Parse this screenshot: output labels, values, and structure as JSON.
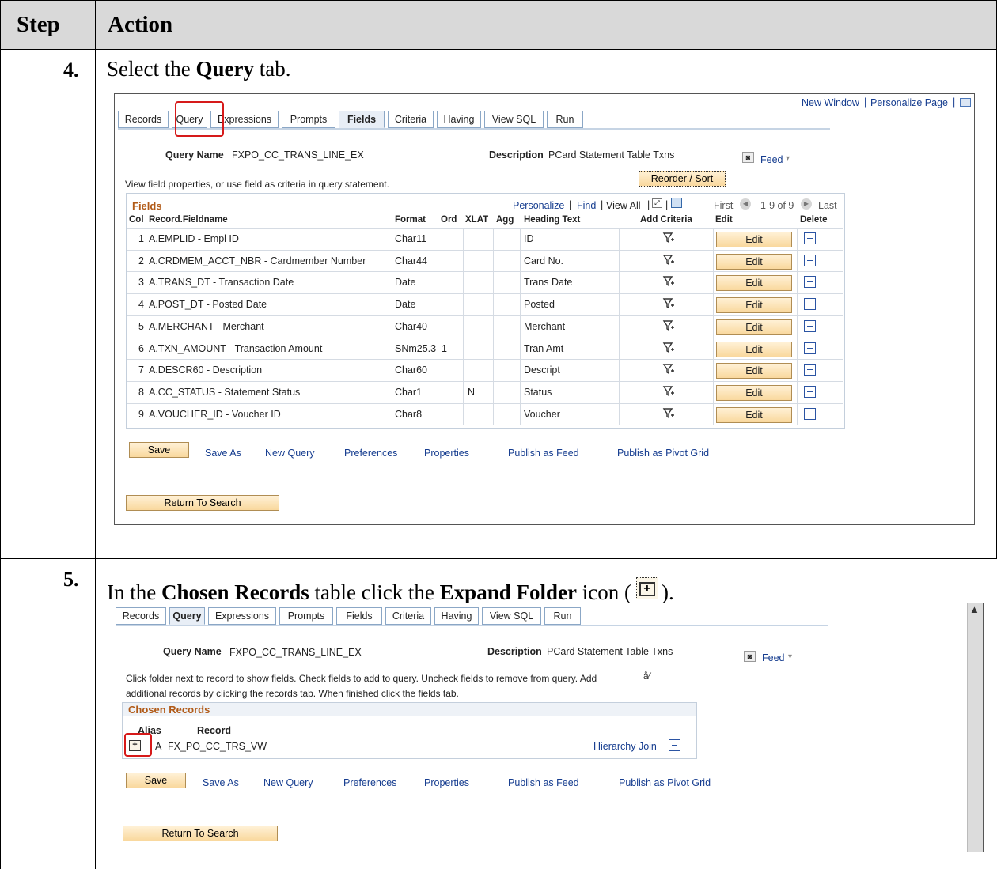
{
  "header": {
    "step_label": "Step",
    "action_label": "Action"
  },
  "step4": {
    "number": "4.",
    "instruction_pre": "Select the ",
    "instruction_bold": "Query",
    "instruction_post": " tab.",
    "top_links": {
      "new_window": "New Window",
      "personalize_page": "Personalize Page"
    },
    "tabs": [
      "Records",
      "Query",
      "Expressions",
      "Prompts",
      "Fields",
      "Criteria",
      "Having",
      "View SQL",
      "Run"
    ],
    "selected_tab": "Fields",
    "query_name_label": "Query Name",
    "query_name_value": "FXPO_CC_TRANS_LINE_EX",
    "description_label": "Description",
    "description_value": "PCard Statement Table Txns",
    "feed_label": "Feed",
    "reorder_label": "Reorder / Sort",
    "help_text": "View field properties, or use field as criteria in query statement.",
    "grid_title": "Fields",
    "grid_nav": {
      "personalize": "Personalize",
      "find": "Find",
      "view_all": "View All",
      "first": "First",
      "range": "1-9 of 9",
      "last": "Last"
    },
    "columns": [
      "Col",
      "Record.Fieldname",
      "Format",
      "Ord",
      "XLAT",
      "Agg",
      "Heading Text",
      "Add Criteria",
      "Edit",
      "Delete"
    ],
    "edit_label": "Edit",
    "rows": [
      {
        "col": "1",
        "field": "A.EMPLID - Empl ID",
        "format": "Char11",
        "ord": "",
        "xlat": "",
        "agg": "",
        "heading": "ID"
      },
      {
        "col": "2",
        "field": "A.CRDMEM_ACCT_NBR - Cardmember Number",
        "format": "Char44",
        "ord": "",
        "xlat": "",
        "agg": "",
        "heading": "Card No."
      },
      {
        "col": "3",
        "field": "A.TRANS_DT - Transaction Date",
        "format": "Date",
        "ord": "",
        "xlat": "",
        "agg": "",
        "heading": "Trans Date"
      },
      {
        "col": "4",
        "field": "A.POST_DT - Posted Date",
        "format": "Date",
        "ord": "",
        "xlat": "",
        "agg": "",
        "heading": "Posted"
      },
      {
        "col": "5",
        "field": "A.MERCHANT - Merchant",
        "format": "Char40",
        "ord": "",
        "xlat": "",
        "agg": "",
        "heading": "Merchant"
      },
      {
        "col": "6",
        "field": "A.TXN_AMOUNT - Transaction Amount",
        "format": "SNm25.3",
        "ord": "1",
        "xlat": "",
        "agg": "",
        "heading": "Tran Amt"
      },
      {
        "col": "7",
        "field": "A.DESCR60 - Description",
        "format": "Char60",
        "ord": "",
        "xlat": "",
        "agg": "",
        "heading": "Descript"
      },
      {
        "col": "8",
        "field": "A.CC_STATUS - Statement Status",
        "format": "Char1",
        "ord": "",
        "xlat": "N",
        "agg": "",
        "heading": "Status"
      },
      {
        "col": "9",
        "field": "A.VOUCHER_ID - Voucher ID",
        "format": "Char8",
        "ord": "",
        "xlat": "",
        "agg": "",
        "heading": "Voucher"
      }
    ],
    "actions": {
      "save": "Save",
      "save_as": "Save As",
      "new_query": "New Query",
      "preferences": "Preferences",
      "properties": "Properties",
      "publish_feed": "Publish as Feed",
      "publish_pivot": "Publish as Pivot Grid"
    },
    "return_label": "Return To Search"
  },
  "step5": {
    "number": "5.",
    "instruction_p1": "In the ",
    "instruction_b1": "Chosen Records",
    "instruction_p2": " table click the ",
    "instruction_b2": "Expand Folder",
    "instruction_p3": " icon (",
    "instruction_p4": ").",
    "tabs": [
      "Records",
      "Query",
      "Expressions",
      "Prompts",
      "Fields",
      "Criteria",
      "Having",
      "View SQL",
      "Run"
    ],
    "selected_tab": "Query",
    "query_name_label": "Query Name",
    "query_name_value": "FXPO_CC_TRANS_LINE_EX",
    "description_label": "Description",
    "description_value": "PCard Statement Table Txns",
    "feed_label": "Feed",
    "help_line1": "Click folder next to record to show fields. Check fields to add to query. Uncheck fields to remove from query. Add",
    "help_line2": "additional records by clicking the records tab. When finished click the fields tab.",
    "chosen_title": "Chosen Records",
    "alias_header": "Alias",
    "record_header": "Record",
    "alias_value": "A",
    "record_value": "FX_PO_CC_TRS_VW",
    "hierarchy_join": "Hierarchy Join",
    "actions": {
      "save": "Save",
      "save_as": "Save As",
      "new_query": "New Query",
      "preferences": "Preferences",
      "properties": "Properties",
      "publish_feed": "Publish as Feed",
      "publish_pivot": "Publish as Pivot Grid"
    },
    "return_label": "Return To Search"
  },
  "colors": {
    "header_bg": "#d9d9d9",
    "link": "#153c8f",
    "grid_title": "#b15a17",
    "highlight": "#d61a1a",
    "button_fill": "#f9d89d"
  }
}
